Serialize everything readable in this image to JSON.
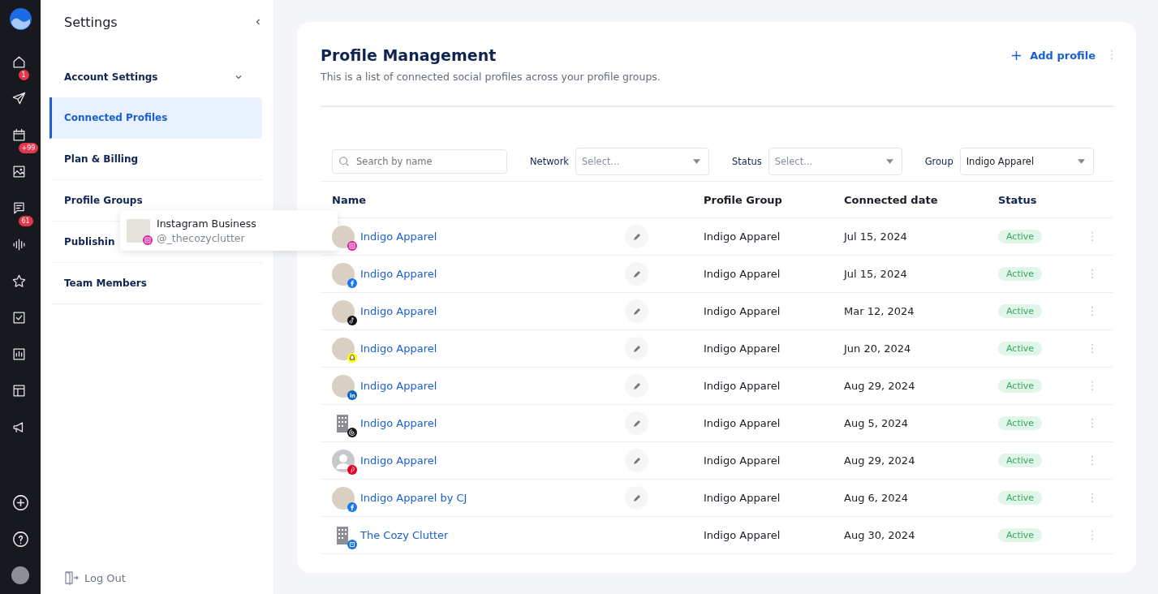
{
  "rail": {
    "items": [
      {
        "kind": "home",
        "badge": "1"
      },
      {
        "kind": "send"
      },
      {
        "kind": "calendar",
        "badge": "+99"
      },
      {
        "kind": "image"
      },
      {
        "kind": "chat",
        "badge": "61"
      },
      {
        "kind": "wave"
      },
      {
        "kind": "star"
      },
      {
        "kind": "check"
      },
      {
        "kind": "chart"
      },
      {
        "kind": "layout"
      },
      {
        "kind": "megaphone"
      }
    ],
    "bottom": [
      {
        "kind": "plus"
      },
      {
        "kind": "help"
      },
      {
        "kind": "avatar"
      }
    ]
  },
  "settings": {
    "title": "Settings",
    "items": [
      {
        "label": "Account Settings",
        "selected": false,
        "expandable": true
      },
      {
        "label": "Connected Profiles",
        "selected": true,
        "expandable": false
      },
      {
        "label": "Plan & Billing",
        "selected": false,
        "expandable": false
      },
      {
        "label": "Profile Groups",
        "selected": false,
        "expandable": false
      },
      {
        "label": "Publishin",
        "selected": false,
        "expandable": false
      },
      {
        "label": "Team Members",
        "selected": false,
        "expandable": false
      }
    ],
    "logout": "Log Out"
  },
  "tooltip": {
    "title": "Instagram Business",
    "handle": "@_thecozyclutter",
    "network": {
      "kind": "instagram",
      "color": "#d6249f"
    }
  },
  "page": {
    "title": "Profile Management",
    "subtitle": "This is a list of connected social profiles across your profile groups.",
    "add_button": "Add profile"
  },
  "filters": {
    "search": {
      "placeholder": "Search by name"
    },
    "dropdowns": [
      {
        "label": "Network",
        "placeholder": "Select..."
      },
      {
        "label": "Status",
        "placeholder": "Select..."
      },
      {
        "label": "Group",
        "value": "Indigo Apparel"
      }
    ]
  },
  "table": {
    "columns": [
      "Name",
      "Profile Group",
      "Connected date",
      "Status"
    ],
    "rows": [
      {
        "name": "Indigo Apparel",
        "avatar": {
          "kind": "photo"
        },
        "network": {
          "kind": "instagram",
          "color": "#d6249f"
        },
        "editable": true,
        "group": "Indigo Apparel",
        "date": "Jul 15, 2024",
        "status": "Active"
      },
      {
        "name": "Indigo Apparel",
        "avatar": {
          "kind": "photo"
        },
        "network": {
          "kind": "facebook",
          "color": "#1877f2"
        },
        "editable": true,
        "group": "Indigo Apparel",
        "date": "Jul 15, 2024",
        "status": "Active"
      },
      {
        "name": "Indigo Apparel",
        "avatar": {
          "kind": "photo"
        },
        "network": {
          "kind": "tiktok",
          "color": "#111111"
        },
        "editable": true,
        "group": "Indigo Apparel",
        "date": "Mar 12, 2024",
        "status": "Active"
      },
      {
        "name": "Indigo Apparel",
        "avatar": {
          "kind": "photo"
        },
        "network": {
          "kind": "snapchat",
          "color": "#fffc00"
        },
        "editable": true,
        "group": "Indigo Apparel",
        "date": "Jun 20, 2024",
        "status": "Active"
      },
      {
        "name": "Indigo Apparel",
        "avatar": {
          "kind": "photo"
        },
        "network": {
          "kind": "linkedin",
          "color": "#0a66c2"
        },
        "editable": true,
        "group": "Indigo Apparel",
        "date": "Aug 29, 2024",
        "status": "Active"
      },
      {
        "name": "Indigo Apparel",
        "avatar": {
          "kind": "building"
        },
        "network": {
          "kind": "threads",
          "color": "#111111"
        },
        "editable": true,
        "group": "Indigo Apparel",
        "date": "Aug 5, 2024",
        "status": "Active"
      },
      {
        "name": "Indigo Apparel",
        "avatar": {
          "kind": "person"
        },
        "network": {
          "kind": "pinterest",
          "color": "#e60023"
        },
        "editable": true,
        "group": "Indigo Apparel",
        "date": "Aug 29, 2024",
        "status": "Active"
      },
      {
        "name": "Indigo Apparel by CJ",
        "avatar": {
          "kind": "photo"
        },
        "network": {
          "kind": "facebook",
          "color": "#1877f2"
        },
        "editable": true,
        "group": "Indigo Apparel",
        "date": "Aug 6, 2024",
        "status": "Active"
      },
      {
        "name": "The Cozy Clutter",
        "avatar": {
          "kind": "building"
        },
        "network": {
          "kind": "business",
          "color": "#1a73e8"
        },
        "editable": false,
        "group": "Indigo Apparel",
        "date": "Aug 30, 2024",
        "status": "Active"
      }
    ]
  }
}
